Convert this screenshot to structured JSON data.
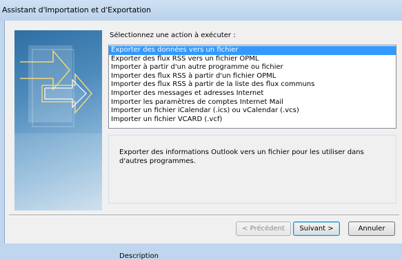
{
  "window": {
    "title": "Assistant d'Importation et d'Exportation"
  },
  "prompt_label": "Sélectionnez une action à exécuter :",
  "actions": [
    {
      "label": "Exporter des données vers un fichier",
      "selected": true
    },
    {
      "label": "Exporter des flux RSS vers un fichier OPML",
      "selected": false
    },
    {
      "label": "Importer à partir d'un autre programme ou fichier",
      "selected": false
    },
    {
      "label": "Importer des flux RSS à partir d'un fichier OPML",
      "selected": false
    },
    {
      "label": "Importer des flux RSS à partir de la liste des flux communs",
      "selected": false
    },
    {
      "label": "Importer des messages et adresses Internet",
      "selected": false
    },
    {
      "label": "Importer les paramètres de comptes Internet Mail",
      "selected": false
    },
    {
      "label": "Importer un fichier iCalendar (.ics) ou vCalendar (.vcs)",
      "selected": false
    },
    {
      "label": "Importer un fichier VCARD (.vcf)",
      "selected": false
    }
  ],
  "description": {
    "title": "Description",
    "text": "Exporter des informations Outlook vers un fichier pour les utiliser dans d'autres programmes."
  },
  "buttons": {
    "back": "< Précédent",
    "next": "Suivant >",
    "cancel": "Annuler"
  },
  "colors": {
    "selection": "#3399ff",
    "titlebar": "#bfd6ee"
  }
}
